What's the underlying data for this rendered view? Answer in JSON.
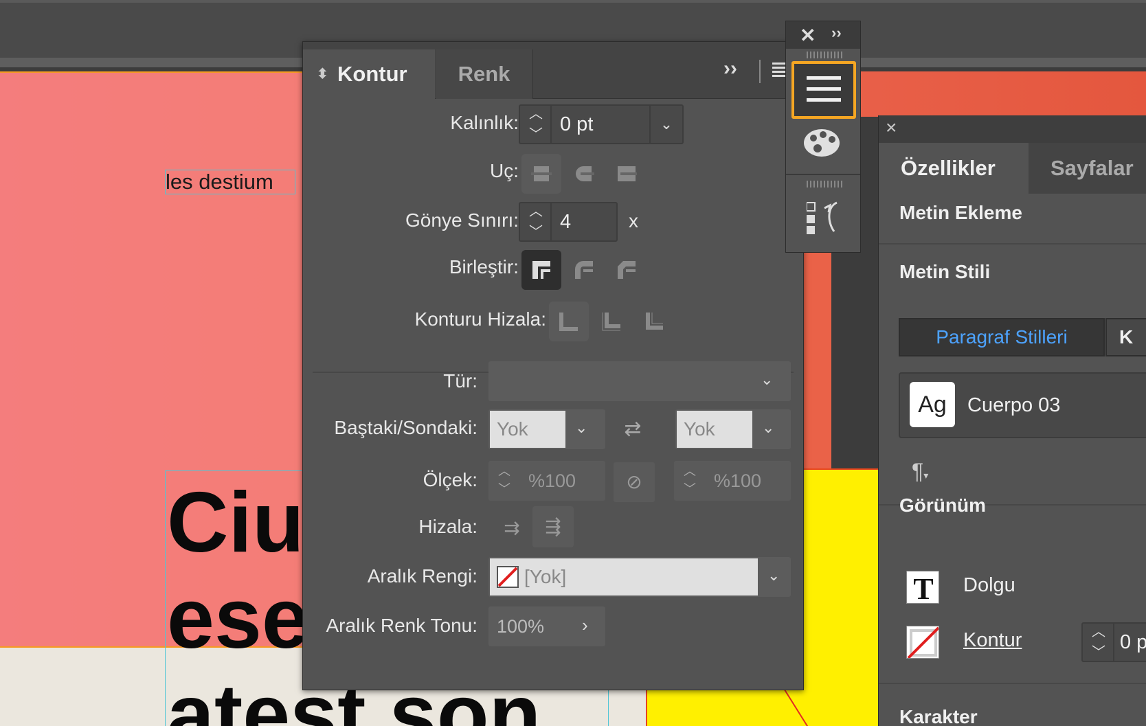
{
  "canvas": {
    "small_text": "les destium",
    "big_lines": [
      "Ciu",
      "ese",
      "atest  son"
    ]
  },
  "stroke_panel": {
    "tabs": [
      {
        "label": "Kontur",
        "active": true
      },
      {
        "label": "Renk",
        "active": false
      }
    ],
    "weight": {
      "label": "Kalınlık:",
      "value": "0 pt"
    },
    "cap": {
      "label": "Uç:"
    },
    "miter": {
      "label": "Gönye Sınırı:",
      "value": "4",
      "suffix": "x"
    },
    "join": {
      "label": "Birleştir:",
      "selected": "miter-join"
    },
    "align": {
      "label": "Konturu Hizala:"
    },
    "type": {
      "label": "Tür:",
      "value": ""
    },
    "start_end": {
      "label": "Baştaki/Sondaki:",
      "start": "Yok",
      "end": "Yok"
    },
    "scale": {
      "label": "Ölçek:",
      "start": "%100",
      "end": "%100"
    },
    "align_arrows": {
      "label": "Hizala:"
    },
    "gap_color": {
      "label": "Aralık Rengi:",
      "value": "[Yok]"
    },
    "gap_tint": {
      "label": "Aralık Renk Tonu:",
      "value": "100%"
    }
  },
  "mini_toolbar": {
    "items": [
      "stroke-icon",
      "color-palette-icon",
      "pages-icon"
    ]
  },
  "properties_panel": {
    "tabs": [
      {
        "label": "Özellikler",
        "active": true
      },
      {
        "label": "Sayfalar",
        "active": false
      }
    ],
    "text_insert": "Metin Ekleme",
    "text_style": "Metin Stili",
    "paragraph_styles_btn": "Paragraf Stilleri",
    "char_styles_btn": "K",
    "style_swatch": "Ag",
    "style_name": "Cuerpo 03",
    "appearance": "Görünüm",
    "fill_label": "Dolgu",
    "stroke_label": "Kontur",
    "stroke_value": "0 p",
    "character": "Karakter"
  },
  "colors": {
    "accent_orange": "#f5a623",
    "link_blue": "#4da3ff",
    "doc_pink": "#f47d7d",
    "doc_yellow": "#fff000"
  }
}
